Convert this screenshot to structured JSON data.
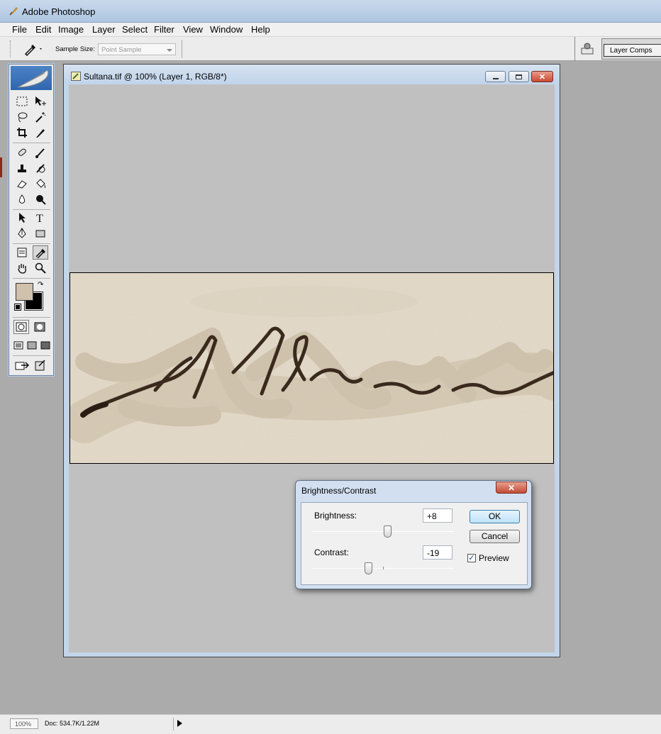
{
  "window": {
    "title": "Adobe Photoshop"
  },
  "menu": [
    "File",
    "Edit",
    "Image",
    "Layer",
    "Select",
    "Filter",
    "View",
    "Window",
    "Help"
  ],
  "options": {
    "sample_size_label": "Sample Size:",
    "sample_size_value": "Point Sample",
    "palette_tab": "Layer Comps"
  },
  "document": {
    "title": "Sultana.tif @ 100% (Layer 1, RGB/8*)"
  },
  "colors": {
    "foreground": "#cfc1ab",
    "background": "#000000"
  },
  "dialog": {
    "title": "Brightness/Contrast",
    "brightness_label": "Brightness:",
    "brightness_value": "+8",
    "contrast_label": "Contrast:",
    "contrast_value": "-19",
    "ok_label": "OK",
    "cancel_label": "Cancel",
    "preview_label": "Preview",
    "preview_checked": true
  },
  "status": {
    "zoom": "100%",
    "doc_info": "Doc: 534.7K/1.22M"
  }
}
